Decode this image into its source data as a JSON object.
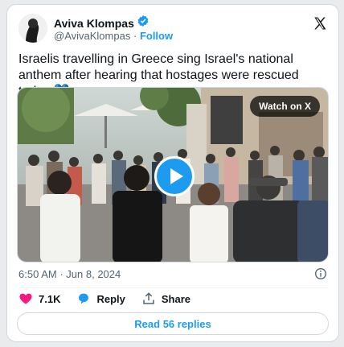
{
  "author": {
    "name": "Aviva Klompas",
    "handle": "@AvivaKlompas",
    "separator": "·",
    "follow_label": "Follow",
    "verified_icon": "verified-badge-icon"
  },
  "tweet": {
    "text": "Israelis travelling in Greece sing Israel's national anthem after hearing that hostages were rescued today 💙"
  },
  "media": {
    "watch_label": "Watch on X",
    "play_icon": "play-icon"
  },
  "meta": {
    "time": "6:50 AM",
    "separator": "·",
    "date": "Jun 8, 2024"
  },
  "actions": {
    "likes": "7.1K",
    "reply_label": "Reply",
    "share_label": "Share"
  },
  "replies_button": {
    "label": "Read 56 replies"
  },
  "colors": {
    "accent": "#1d9bf0",
    "like": "#f91880",
    "text": "#0f1419",
    "muted": "#536471"
  }
}
